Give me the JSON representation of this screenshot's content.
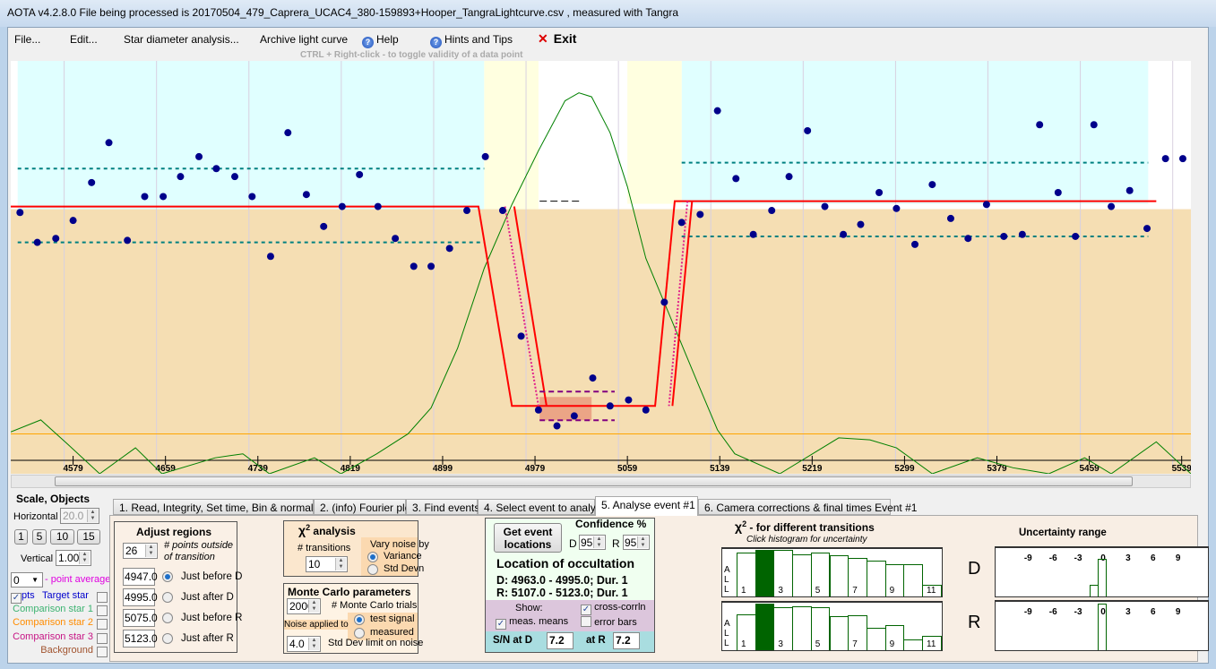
{
  "window": {
    "title": "AOTA v4.2.8.0   File being processed is  20170504_479_Caprera_UCAC4_380-159893+Hooper_TangraLightcurve.csv ,  measured with Tangra"
  },
  "menu": {
    "file": "File...",
    "edit": "Edit...",
    "star_diameter": "Star diameter analysis...",
    "archive": "Archive light curve",
    "help": "Help",
    "hints": "Hints and Tips",
    "exit": "Exit",
    "exit_icon": "x-icon",
    "help_icon": "question-icon"
  },
  "hint": "CTRL + Right-click   -   to toggle validity of a data point",
  "colors": {
    "baseline_region": "#e0ffff",
    "event_region": "#f5deb3",
    "transition_region": "#ffffe0",
    "points": "#00008b",
    "model": "#ff0000",
    "cross_correlation": "#008000",
    "zero_line": "#ffa500",
    "mean_lines": "#008080"
  },
  "chart_data": {
    "type": "scatter",
    "title": "",
    "xlabel": "",
    "ylabel": "",
    "xlim": [
      4525,
      5547
    ],
    "ylim": [
      -0.34,
      1.73
    ],
    "x_ticks": [
      4579,
      4659,
      4739,
      4819,
      4899,
      4979,
      5059,
      5139,
      5219,
      5299,
      5379,
      5459,
      5539
    ],
    "points": {
      "x": [
        4533,
        4548,
        4564,
        4579,
        4595,
        4610,
        4626,
        4641,
        4657,
        4672,
        4688,
        4703,
        4719,
        4734,
        4750,
        4765,
        4781,
        4796,
        4812,
        4827,
        4843,
        4858,
        4874,
        4889,
        4905,
        4920,
        4936,
        4951,
        4967,
        4982,
        4998,
        5013,
        5029,
        5044,
        5060,
        5075,
        5091,
        5106,
        5122,
        5137,
        5153,
        5168,
        5184,
        5199,
        5215,
        5230,
        5246,
        5261,
        5277,
        5292,
        5308,
        5323,
        5339,
        5354,
        5370,
        5385,
        5401,
        5416,
        5432,
        5447,
        5463,
        5478,
        5494,
        5509,
        5525,
        5540
      ],
      "y": [
        0.97,
        0.82,
        0.84,
        0.93,
        1.12,
        1.32,
        0.83,
        1.05,
        1.05,
        1.15,
        1.25,
        1.19,
        1.15,
        1.05,
        0.75,
        1.37,
        1.06,
        0.9,
        1.0,
        1.16,
        1.0,
        0.84,
        0.7,
        0.7,
        0.79,
        0.98,
        1.25,
        0.98,
        0.35,
        -0.02,
        -0.1,
        -0.05,
        0.14,
        0.0,
        0.03,
        -0.02,
        0.52,
        0.92,
        0.96,
        1.48,
        1.14,
        0.86,
        0.98,
        1.15,
        1.38,
        1.0,
        0.86,
        0.91,
        1.07,
        0.99,
        0.81,
        1.11,
        0.94,
        0.84,
        1.01,
        0.85,
        0.86,
        1.41,
        1.07,
        0.85,
        1.41,
        1.0,
        1.08,
        0.89,
        1.24,
        1.24
      ]
    },
    "cross_correlation": {
      "x": [
        4525,
        4551,
        4574,
        4602,
        4633,
        4656,
        4702,
        4726,
        4749,
        4788,
        4811,
        4842,
        4869,
        4889,
        4912,
        4935,
        4959,
        4982,
        5005,
        5017,
        5028,
        5044,
        5059,
        5075,
        5098,
        5121,
        5137,
        5152,
        5191,
        5242,
        5269,
        5292,
        5323,
        5362,
        5393,
        5424,
        5455,
        5478,
        5517,
        5547
      ],
      "y": [
        -0.13,
        -0.07,
        -0.19,
        -0.34,
        -0.21,
        -0.34,
        -0.26,
        -0.24,
        -0.34,
        -0.26,
        -0.34,
        -0.24,
        -0.14,
        -0.01,
        0.29,
        0.69,
        1.01,
        1.28,
        1.53,
        1.57,
        1.55,
        1.37,
        1.1,
        0.74,
        0.42,
        0.1,
        -0.12,
        -0.24,
        -0.34,
        -0.16,
        -0.17,
        -0.21,
        -0.34,
        -0.26,
        -0.31,
        -0.34,
        -0.26,
        -0.34,
        -0.18,
        -0.34
      ]
    },
    "model": {
      "baseline": 1.0,
      "bottom": 0.0,
      "d_start": 4930,
      "d_end": 4959,
      "r_start": 5083,
      "r_end": 5100
    },
    "regions": {
      "transition_d": [
        4935,
        4982
      ],
      "transition_r": [
        5059,
        5106
      ],
      "baseline_left": [
        4531,
        4935
      ],
      "baseline_right": [
        5106,
        5510
      ]
    },
    "mean_lines": {
      "left": [
        1.19,
        0.82
      ],
      "right": [
        1.22,
        0.85
      ]
    },
    "zero_line": -0.14
  },
  "scale": {
    "title": "Scale, Objects",
    "horizontal_label": "Horizontal",
    "horizontal": "20.0",
    "buttons": [
      "1",
      "5",
      "10",
      "15"
    ],
    "vertical_label": "Vertical",
    "vertical": "1.00",
    "point_avg": "0",
    "point_avg_label": "- point average",
    "pts_label": "pts",
    "pts_checked": true,
    "objects": [
      {
        "label": "Target star",
        "color": "#0000cd"
      },
      {
        "label": "Comparison star 1",
        "color": "#3cb371"
      },
      {
        "label": "Comparison star 2",
        "color": "#ff8c00"
      },
      {
        "label": "Comparison star 3",
        "color": "#c71585"
      },
      {
        "label": "Background",
        "color": "#a0522d"
      }
    ]
  },
  "tabs": [
    "1.  Read, Integrity, Set time, Bin & normalise",
    "2. (info)  Fourier plot",
    "3. Find events",
    "4. Select event to analyse",
    "5. Analyse event #1",
    "6. Camera corrections & final times Event #1"
  ],
  "adjust": {
    "title": "Adjust regions",
    "points": "26",
    "points_label": "# points outside of transition",
    "rows": [
      {
        "value": "4947.0",
        "label": "Just before D",
        "selected": true
      },
      {
        "value": "4995.0",
        "label": "Just after D",
        "selected": false
      },
      {
        "value": "5075.0",
        "label": "Just before R",
        "selected": false
      },
      {
        "value": "5123.0",
        "label": "Just after R",
        "selected": false
      }
    ]
  },
  "chi": {
    "title": "analysis",
    "symbol": "χ",
    "sup": "2",
    "transitions_label": "# transitions",
    "transitions": "10",
    "vary_label": "Vary noise by",
    "variance": "Variance",
    "stddev": "Std Devn"
  },
  "monte": {
    "title": "Monte Carlo parameters",
    "trials": "2000",
    "trials_label": "# Monte Carlo trials",
    "noise_label": "Noise applied to",
    "test_signal": "test signal",
    "measured": "measured",
    "stddev_limit": "4.0",
    "stddev_label": "Std Dev limit on noise"
  },
  "event": {
    "get_button": "Get event locations",
    "confidence_label": "Confidence %",
    "d_label": "D",
    "d_conf": "95",
    "r_label": "R",
    "r_conf": "95",
    "location_title": "Location of occultation",
    "d_line": "D: 4963.0 - 4995.0; Dur. 1",
    "r_line": "R: 5107.0 - 5123.0; Dur. 1",
    "show_label": "Show:",
    "cross_corr": "cross-corrln",
    "meas_means": "meas. means",
    "error_bars": "error bars",
    "sn_label": "S/N   at D",
    "sn_d": "7.2",
    "sn_r_label": "at R",
    "sn_r": "7.2"
  },
  "histogram": {
    "title": "- for different transitions",
    "subtitle": "Click histogram for uncertainty",
    "side_label": [
      "A",
      "L",
      "L"
    ],
    "labels": [
      "1",
      "3",
      "5",
      "7",
      "9",
      "11"
    ],
    "selected": 2,
    "d": [
      0.95,
      1,
      1,
      0.9,
      0.95,
      0.89,
      0.83,
      0.77,
      0.7,
      0.7,
      0.25
    ],
    "r": [
      0.76,
      1,
      0.92,
      0.94,
      0.92,
      0.73,
      0.75,
      0.48,
      0.54,
      0.24,
      0.31
    ],
    "d_label": "D",
    "r_label": "R"
  },
  "uncertainty": {
    "title": "Uncertainty range",
    "ticks": [
      "-9",
      "-6",
      "-3",
      "0",
      "3",
      "6",
      "9"
    ],
    "d": [
      {
        "offset": -1,
        "value": 0.25
      },
      {
        "offset": 0,
        "value": 0.8
      }
    ],
    "r": [
      {
        "offset": 0,
        "value": 1.0
      }
    ]
  }
}
